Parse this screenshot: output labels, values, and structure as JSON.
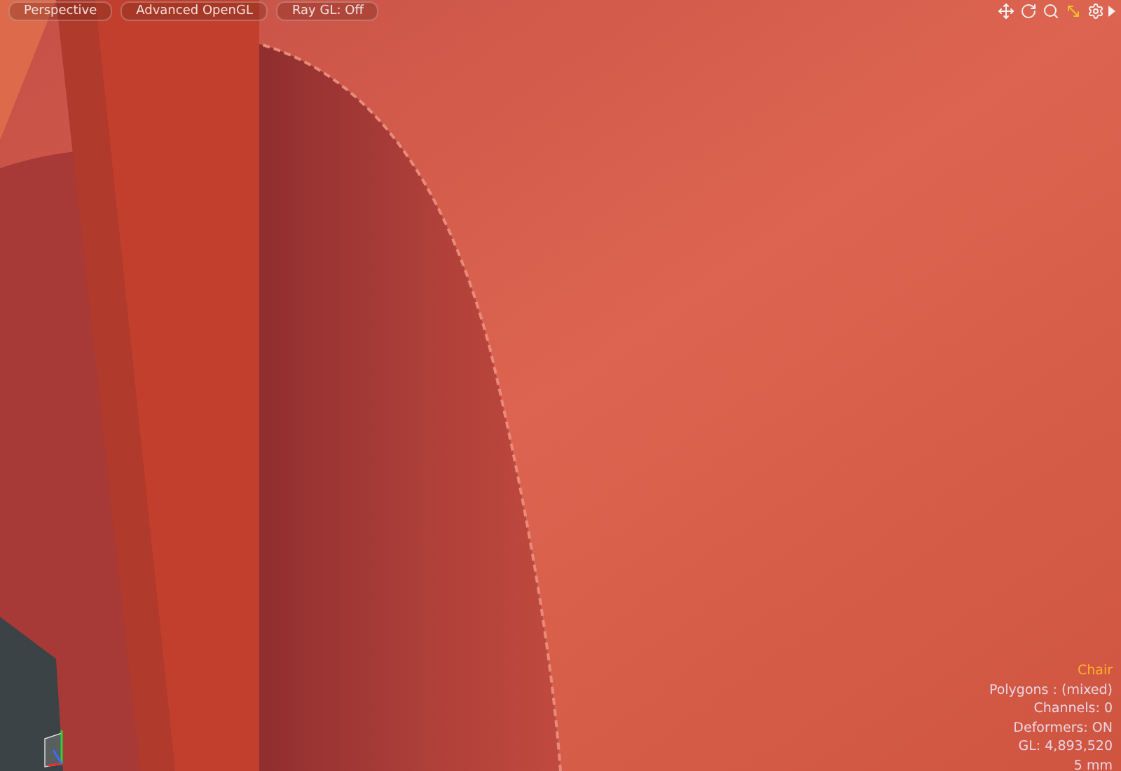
{
  "viewport": {
    "buttons": [
      {
        "label": "Perspective"
      },
      {
        "label": "Advanced OpenGL"
      },
      {
        "label": "Ray GL: Off"
      }
    ],
    "info": {
      "title": "Chair",
      "lines": [
        "Polygons : (mixed)",
        "Channels: 0",
        "Deformers: ON",
        "GL: 4,893,520",
        "5 mm"
      ]
    }
  }
}
